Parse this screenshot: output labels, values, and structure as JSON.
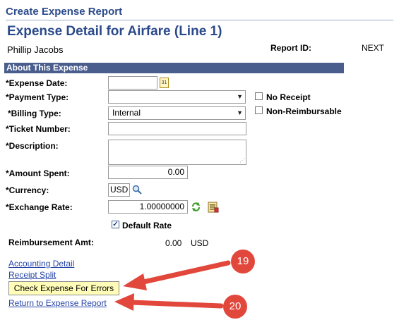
{
  "header": {
    "title": "Create Expense Report",
    "page_title": "Expense Detail for Airfare (Line 1)",
    "employee_name": "Phillip Jacobs",
    "report_id_label": "Report ID:",
    "report_id_value": "NEXT"
  },
  "section": {
    "title": "About This Expense"
  },
  "form": {
    "expense_date": {
      "label": "*Expense Date:",
      "value": ""
    },
    "payment_type": {
      "label": "*Payment Type:",
      "value": ""
    },
    "billing_type": {
      "label": "*Billing Type:",
      "value": "Internal"
    },
    "ticket_number": {
      "label": "*Ticket Number:",
      "value": ""
    },
    "description": {
      "label": "*Description:",
      "value": ""
    },
    "amount_spent": {
      "label": "*Amount Spent:",
      "value": "0.00"
    },
    "currency": {
      "label": "*Currency:",
      "value": "USD"
    },
    "exchange_rate": {
      "label": "*Exchange Rate:",
      "value": "1.00000000"
    },
    "no_receipt": {
      "label": "No Receipt",
      "checked": false
    },
    "non_reimbursable": {
      "label": "Non-Reimbursable",
      "checked": false
    },
    "default_rate": {
      "label": "Default Rate",
      "checked": true
    },
    "reimbursement": {
      "label": "Reimbursement Amt:",
      "amount": "0.00",
      "currency": "USD"
    }
  },
  "links": {
    "accounting_detail": "Accounting Detail",
    "receipt_split": "Receipt Split",
    "check_errors_button": "Check Expense For Errors",
    "return_to_report": "Return to Expense Report"
  },
  "callouts": {
    "first": "19",
    "second": "20"
  },
  "colors": {
    "header_text": "#2b4a8b",
    "section_bar": "#4a5e8e",
    "button_bg": "#fffdb8",
    "callout": "#e2473c",
    "link": "#2644a8"
  },
  "icons": [
    "calendar-icon",
    "dropdown-arrow-icon",
    "lookup-magnifier-icon",
    "refresh-rate-icon",
    "rate-detail-icon",
    "checkbox-icon",
    "arrow-icon"
  ]
}
